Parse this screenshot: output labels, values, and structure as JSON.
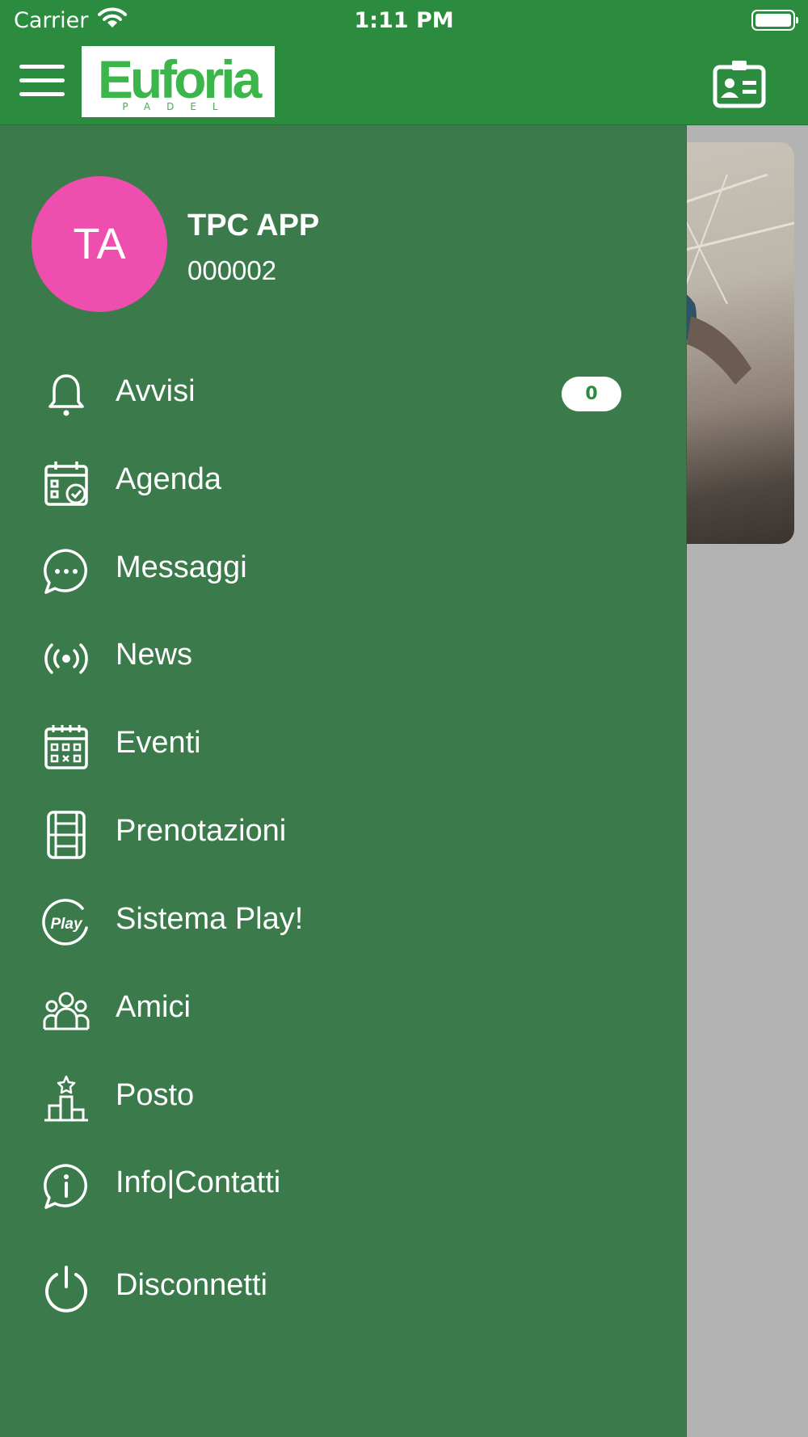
{
  "status_bar": {
    "carrier": "Carrier",
    "time": "1:11 PM"
  },
  "header": {
    "logo_text": "Euforia",
    "logo_subtext": "PADEL"
  },
  "user": {
    "initials": "TA",
    "name": "TPC APP",
    "code": "000002"
  },
  "menu": [
    {
      "label": "Avvisi",
      "icon": "bell-icon",
      "badge": "0"
    },
    {
      "label": "Agenda",
      "icon": "calendar-check-icon"
    },
    {
      "label": "Messaggi",
      "icon": "chat-bubble-icon"
    },
    {
      "label": "News",
      "icon": "broadcast-icon"
    },
    {
      "label": "Eventi",
      "icon": "calendar-grid-icon"
    },
    {
      "label": "Prenotazioni",
      "icon": "court-icon"
    },
    {
      "label": "Sistema Play!",
      "icon": "play-badge-icon",
      "icon_text": "Play"
    },
    {
      "label": "Amici",
      "icon": "friends-icon"
    },
    {
      "label": "Posto",
      "icon": "podium-icon"
    },
    {
      "label": "Info|Contatti",
      "icon": "info-chat-icon"
    },
    {
      "label": "Disconnetti",
      "icon": "power-icon"
    }
  ],
  "colors": {
    "header_green": "#2b8b3e",
    "drawer_green": "#3b7a4a",
    "avatar_pink": "#ee4fae",
    "logo_green": "#3cb54a"
  }
}
